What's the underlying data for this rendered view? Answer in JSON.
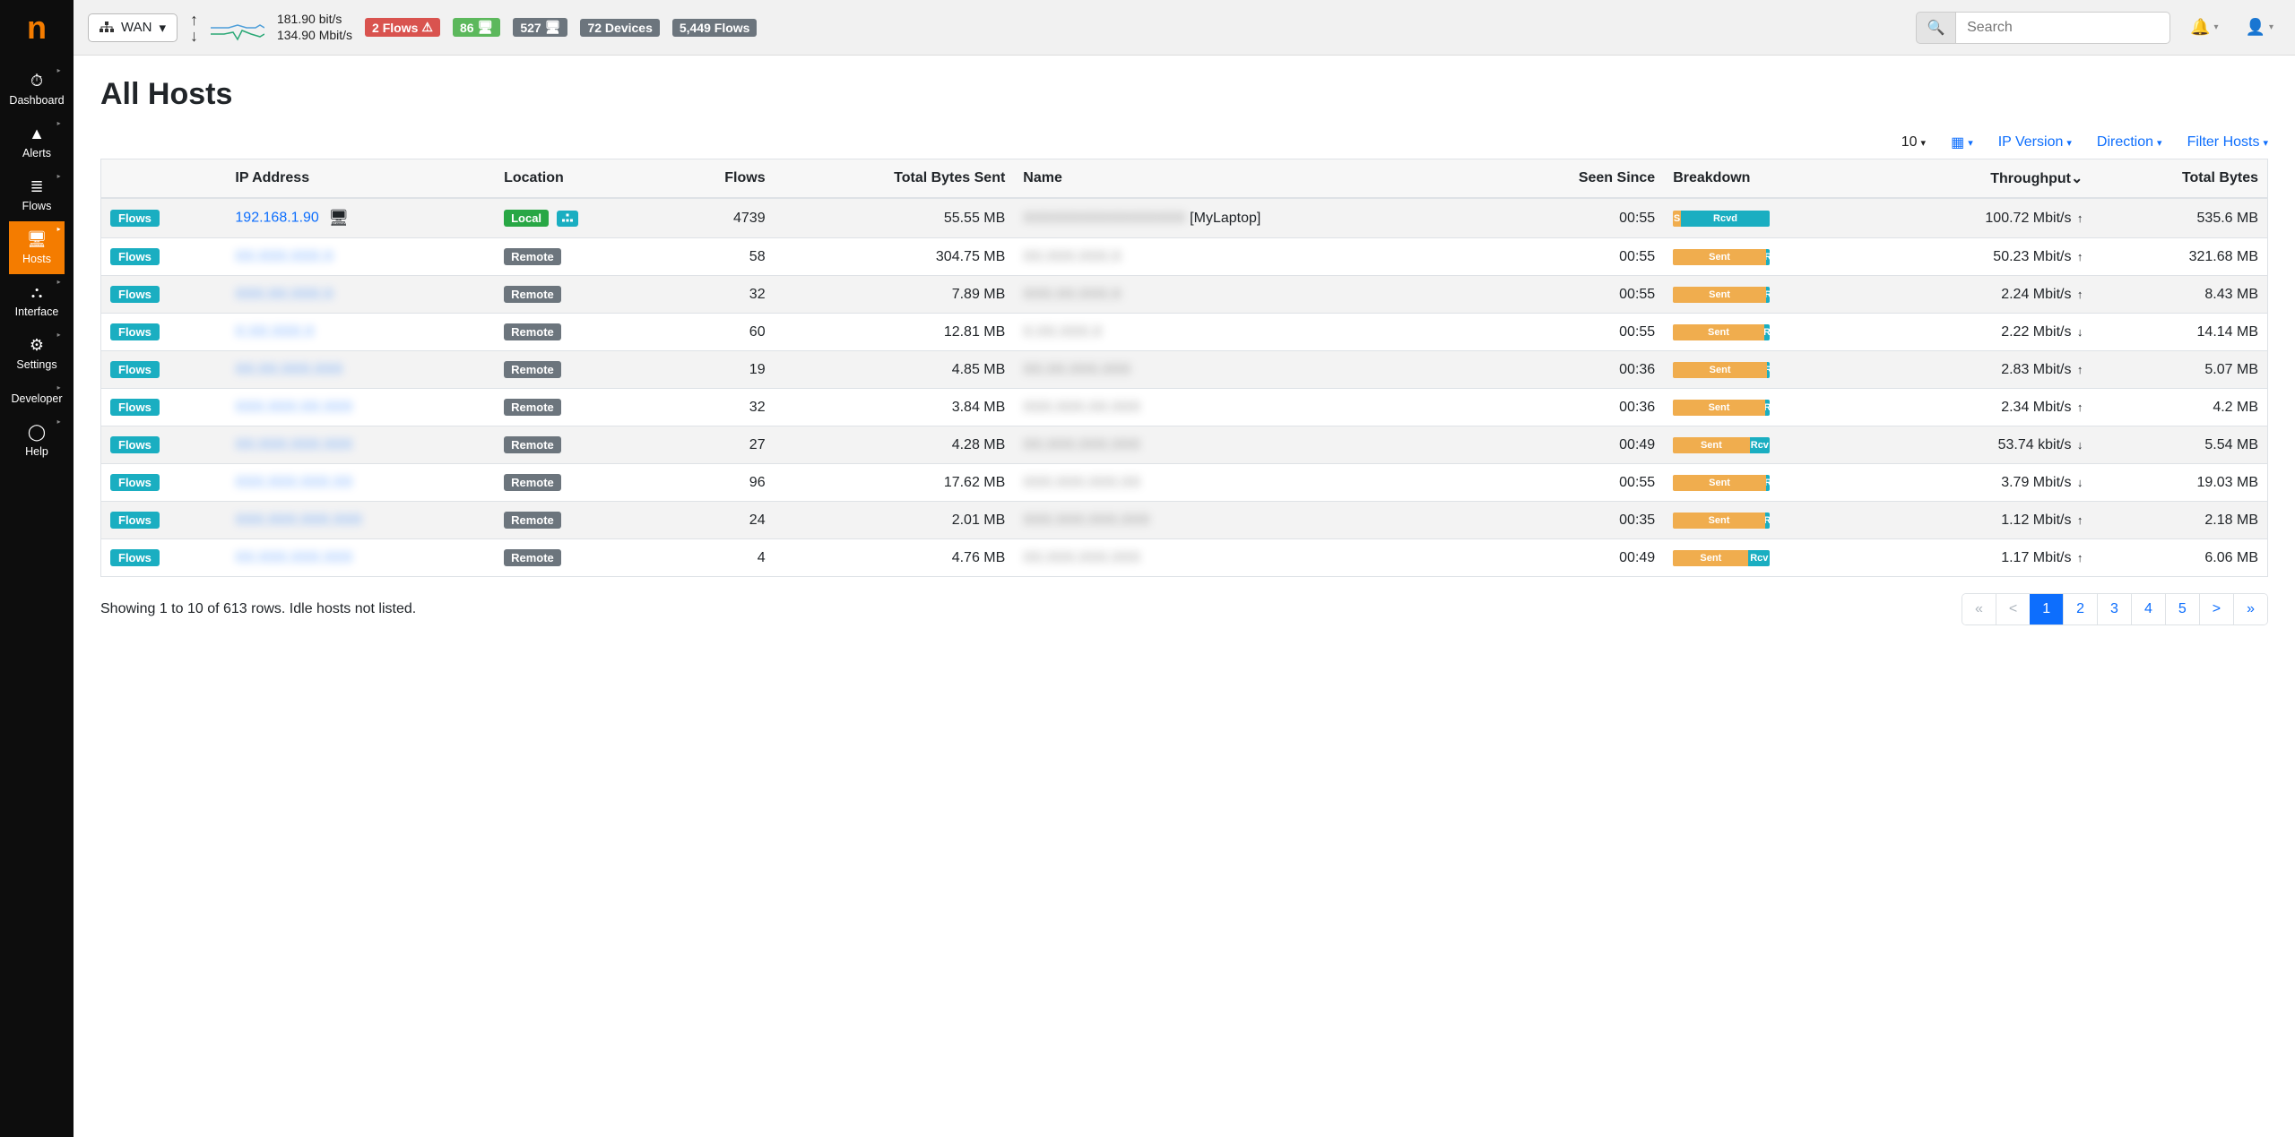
{
  "sidebar": {
    "items": [
      {
        "label": "Dashboard",
        "icon": "⏱"
      },
      {
        "label": "Alerts",
        "icon": "▲"
      },
      {
        "label": "Flows",
        "icon": "≣"
      },
      {
        "label": "Hosts",
        "icon": "🖥"
      },
      {
        "label": "Interface",
        "icon": "⛬"
      },
      {
        "label": "Settings",
        "icon": "⚙"
      },
      {
        "label": "Developer",
        "icon": "</>"
      },
      {
        "label": "Help",
        "icon": "◯"
      }
    ]
  },
  "topbar": {
    "interface": "WAN",
    "rate_up": "181.90 bit/s",
    "rate_down": "134.90 Mbit/s",
    "pills": {
      "flows_alert": "2 Flows",
      "ok_count": "86",
      "hosts_count": "527",
      "devices": "72 Devices",
      "flows": "5,449 Flows"
    },
    "search_placeholder": "Search"
  },
  "page": {
    "title": "All Hosts",
    "page_size": "10",
    "filters": {
      "ip_version": "IP Version",
      "direction": "Direction",
      "filter_hosts": "Filter Hosts"
    },
    "columns": [
      "",
      "IP Address",
      "Location",
      "Flows",
      "Total Bytes Sent",
      "Name",
      "Seen Since",
      "Breakdown",
      "Throughput",
      "Total Bytes"
    ],
    "flows_button_label": "Flows",
    "showing": "Showing 1 to 10 of 613 rows. Idle hosts not listed.",
    "pagination": {
      "current": "1",
      "pages": [
        "1",
        "2",
        "3",
        "4",
        "5"
      ]
    }
  },
  "rows": [
    {
      "ip": "192.168.1.90",
      "ip_blurred": false,
      "os_icons": true,
      "location": "Local",
      "local_net": true,
      "flows": "4739",
      "bytes_sent": "55.55 MB",
      "name": "[MyLaptop]",
      "name_blurred_prefix": "XXXXXXXXXXXXXXXXX",
      "seen": "00:55",
      "breakdown_sent": 8,
      "breakdown_sent_label": "S",
      "breakdown_rcvd_label": "Rcvd",
      "throughput": "100.72 Mbit/s",
      "arrow": "↑",
      "total_bytes": "535.6 MB"
    },
    {
      "ip": "XX.XXX.XXX.X",
      "ip_blurred": true,
      "location": "Remote",
      "flows": "58",
      "bytes_sent": "304.75 MB",
      "name": "XX.XXX.XXX.X",
      "name_blurred_prefix": "",
      "seen": "00:55",
      "breakdown_sent": 96,
      "breakdown_sent_label": "Sent",
      "breakdown_rcvd_label": "R",
      "throughput": "50.23 Mbit/s",
      "arrow": "↑",
      "total_bytes": "321.68 MB"
    },
    {
      "ip": "XXX.XX.XXX.X",
      "ip_blurred": true,
      "location": "Remote",
      "flows": "32",
      "bytes_sent": "7.89 MB",
      "name": "XXX.XX.XXX.X",
      "name_blurred_prefix": "",
      "seen": "00:55",
      "breakdown_sent": 96,
      "breakdown_sent_label": "Sent",
      "breakdown_rcvd_label": "R",
      "throughput": "2.24 Mbit/s",
      "arrow": "↑",
      "total_bytes": "8.43 MB"
    },
    {
      "ip": "X.XX.XXX.X",
      "ip_blurred": true,
      "location": "Remote",
      "flows": "60",
      "bytes_sent": "12.81 MB",
      "name": "X.XX.XXX.X",
      "name_blurred_prefix": "",
      "seen": "00:55",
      "breakdown_sent": 94,
      "breakdown_sent_label": "Sent",
      "breakdown_rcvd_label": "R",
      "throughput": "2.22 Mbit/s",
      "arrow": "↓",
      "total_bytes": "14.14 MB"
    },
    {
      "ip": "XX.XX.XXX.XXX",
      "ip_blurred": true,
      "location": "Remote",
      "flows": "19",
      "bytes_sent": "4.85 MB",
      "name": "XX.XX.XXX.XXX",
      "name_blurred_prefix": "",
      "seen": "00:36",
      "breakdown_sent": 97,
      "breakdown_sent_label": "Sent",
      "breakdown_rcvd_label": "R",
      "throughput": "2.83 Mbit/s",
      "arrow": "↑",
      "total_bytes": "5.07 MB"
    },
    {
      "ip": "XXX.XXX.XX.XXX",
      "ip_blurred": true,
      "location": "Remote",
      "flows": "32",
      "bytes_sent": "3.84 MB",
      "name": "XXX.XXX.XX.XXX",
      "name_blurred_prefix": "",
      "seen": "00:36",
      "breakdown_sent": 95,
      "breakdown_sent_label": "Sent",
      "breakdown_rcvd_label": "R",
      "throughput": "2.34 Mbit/s",
      "arrow": "↑",
      "total_bytes": "4.2 MB"
    },
    {
      "ip": "XX.XXX.XXX.XXX",
      "ip_blurred": true,
      "location": "Remote",
      "flows": "27",
      "bytes_sent": "4.28 MB",
      "name": "XX.XXX.XXX.XXX",
      "name_blurred_prefix": "",
      "seen": "00:49",
      "breakdown_sent": 79,
      "breakdown_sent_label": "Sent",
      "breakdown_rcvd_label": "Rcv",
      "throughput": "53.74 kbit/s",
      "arrow": "↓",
      "total_bytes": "5.54 MB"
    },
    {
      "ip": "XXX.XXX.XXX.XX",
      "ip_blurred": true,
      "location": "Remote",
      "flows": "96",
      "bytes_sent": "17.62 MB",
      "name": "XXX.XXX.XXX.XX",
      "name_blurred_prefix": "",
      "seen": "00:55",
      "breakdown_sent": 96,
      "breakdown_sent_label": "Sent",
      "breakdown_rcvd_label": "R",
      "throughput": "3.79 Mbit/s",
      "arrow": "↓",
      "total_bytes": "19.03 MB"
    },
    {
      "ip": "XXX.XXX.XXX.XXX",
      "ip_blurred": true,
      "location": "Remote",
      "flows": "24",
      "bytes_sent": "2.01 MB",
      "name": "XXX.XXX.XXX.XXX",
      "name_blurred_prefix": "",
      "seen": "00:35",
      "breakdown_sent": 95,
      "breakdown_sent_label": "Sent",
      "breakdown_rcvd_label": "R",
      "throughput": "1.12 Mbit/s",
      "arrow": "↑",
      "total_bytes": "2.18 MB"
    },
    {
      "ip": "XX.XXX.XXX.XXX",
      "ip_blurred": true,
      "location": "Remote",
      "flows": "4",
      "bytes_sent": "4.76 MB",
      "name": "XX.XXX.XXX.XXX",
      "name_blurred_prefix": "",
      "seen": "00:49",
      "breakdown_sent": 78,
      "breakdown_sent_label": "Sent",
      "breakdown_rcvd_label": "Rcv",
      "throughput": "1.17 Mbit/s",
      "arrow": "↑",
      "total_bytes": "6.06 MB"
    }
  ]
}
